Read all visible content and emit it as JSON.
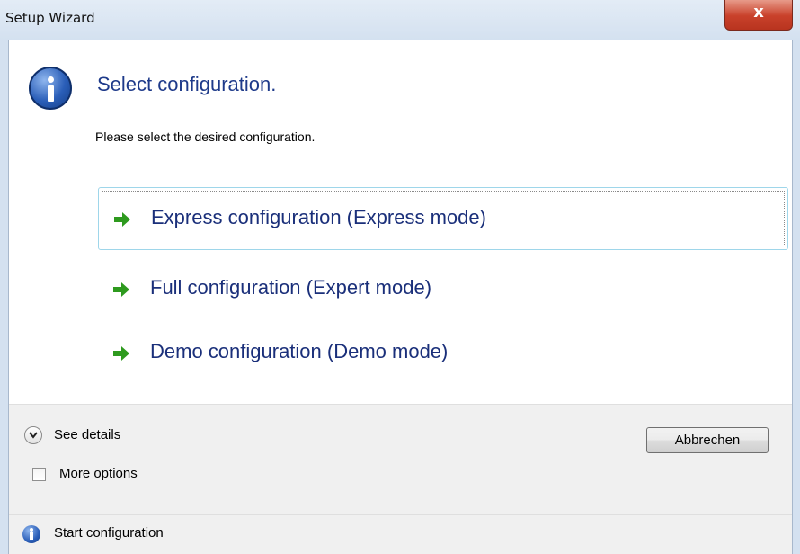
{
  "window": {
    "title": "Setup Wizard",
    "close_label": "x"
  },
  "header": {
    "heading": "Select configuration.",
    "description": "Please select the desired configuration."
  },
  "options": [
    {
      "label": "Express configuration (Express mode)",
      "selected": true,
      "icon": "green-arrow-icon"
    },
    {
      "label": "Full configuration (Expert mode)",
      "selected": false,
      "icon": "green-arrow-icon"
    },
    {
      "label": "Demo configuration (Demo mode)",
      "selected": false,
      "icon": "green-arrow-icon"
    }
  ],
  "footer": {
    "see_details": "See details",
    "more_options": "More options",
    "more_options_checked": false,
    "cancel_button": "Abbrechen"
  },
  "status": {
    "text": "Start configuration",
    "icon": "info-icon"
  },
  "colors": {
    "heading": "#1e3a8a",
    "arrow": "#2e9a1e",
    "selection_border": "#9ed6ea"
  }
}
